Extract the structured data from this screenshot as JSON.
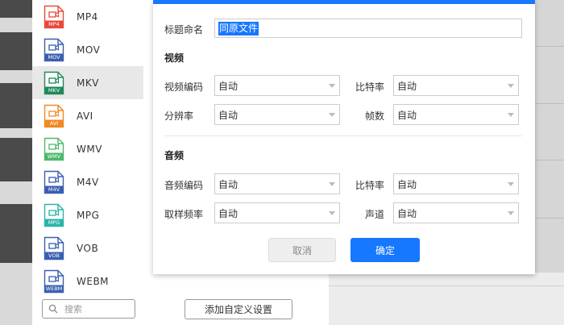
{
  "formats": [
    {
      "name": "MP4",
      "badge": "MP4",
      "color": "#e84a3a",
      "selected": false
    },
    {
      "name": "MOV",
      "badge": "MOV",
      "color": "#3a5fb0",
      "selected": false
    },
    {
      "name": "MKV",
      "badge": "MKV",
      "color": "#1f8a5c",
      "selected": true
    },
    {
      "name": "AVI",
      "badge": "AVI",
      "color": "#f08a24",
      "selected": false
    },
    {
      "name": "WMV",
      "badge": "WMV",
      "color": "#4db86a",
      "selected": false
    },
    {
      "name": "M4V",
      "badge": "M4V",
      "color": "#3a5fb0",
      "selected": false
    },
    {
      "name": "MPG",
      "badge": "MPG",
      "color": "#2bb5a8",
      "selected": false
    },
    {
      "name": "VOB",
      "badge": "VOB",
      "color": "#3a5fb0",
      "selected": false
    },
    {
      "name": "WEBM",
      "badge": "WEBM",
      "color": "#3a5fb0",
      "selected": false
    }
  ],
  "search": {
    "placeholder": "搜索"
  },
  "add_custom_label": "添加自定义设置",
  "dialog": {
    "title_label": "标题命名",
    "title_value": "同原文件",
    "video_section": "视频",
    "audio_section": "音频",
    "video": {
      "codec_label": "视频编码",
      "codec_value": "自动",
      "bitrate_label": "比特率",
      "bitrate_value": "自动",
      "resolution_label": "分辨率",
      "resolution_value": "自动",
      "framerate_label": "帧数",
      "framerate_value": "自动"
    },
    "audio": {
      "codec_label": "音频编码",
      "codec_value": "自动",
      "bitrate_label": "比特率",
      "bitrate_value": "自动",
      "samplerate_label": "取样频率",
      "samplerate_value": "自动",
      "channel_label": "声道",
      "channel_value": "自动"
    },
    "cancel_label": "取消",
    "ok_label": "确定"
  },
  "colors": {
    "accent": "#1677ff"
  }
}
